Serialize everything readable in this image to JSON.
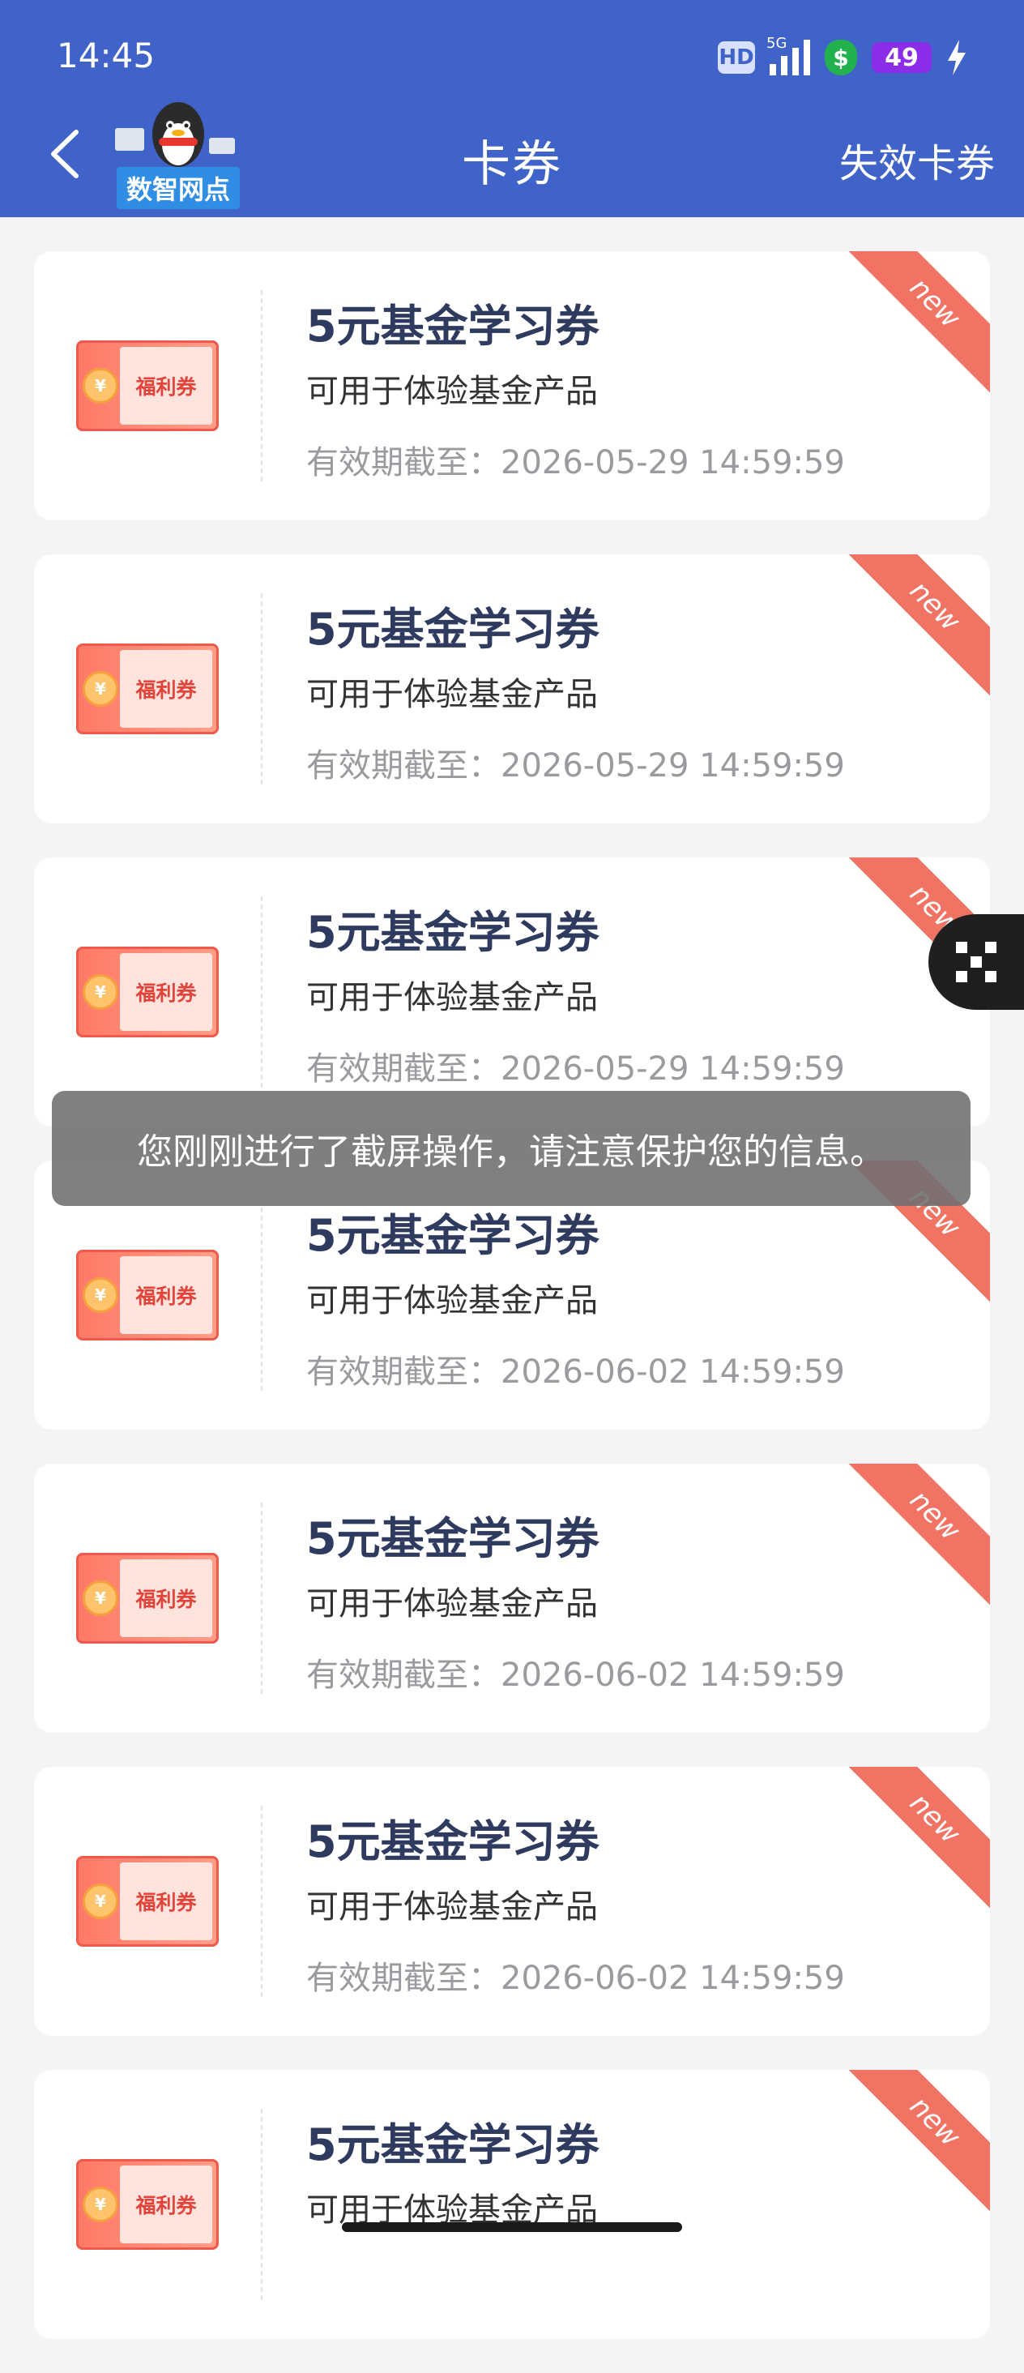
{
  "status_bar": {
    "time": "14:45",
    "hd": "HD",
    "network": "5G",
    "battery": "49"
  },
  "header": {
    "logo_text": "数智网点",
    "title": "卡券",
    "expired_link": "失效卡券"
  },
  "voucher_badge": "福利券",
  "ribbon_label": "new",
  "coupons": [
    {
      "title": "5元基金学习券",
      "desc": "可用于体验基金产品",
      "expiry": "有效期截至：2026-05-29 14:59:59"
    },
    {
      "title": "5元基金学习券",
      "desc": "可用于体验基金产品",
      "expiry": "有效期截至：2026-05-29 14:59:59"
    },
    {
      "title": "5元基金学习券",
      "desc": "可用于体验基金产品",
      "expiry": "有效期截至：2026-05-29 14:59:59"
    },
    {
      "title": "5元基金学习券",
      "desc": "可用于体验基金产品",
      "expiry": "有效期截至：2026-06-02 14:59:59"
    },
    {
      "title": "5元基金学习券",
      "desc": "可用于体验基金产品",
      "expiry": "有效期截至：2026-06-02 14:59:59"
    },
    {
      "title": "5元基金学习券",
      "desc": "可用于体验基金产品",
      "expiry": "有效期截至：2026-06-02 14:59:59"
    },
    {
      "title": "5元基金学习券",
      "desc": "可用于体验基金产品",
      "expiry": ""
    }
  ],
  "toast": "您刚刚进行了截屏操作，请注意保护您的信息。",
  "colors": {
    "header_bg": "#3f63c9",
    "ribbon": "#f07364",
    "title_text": "#2f3a5f"
  }
}
